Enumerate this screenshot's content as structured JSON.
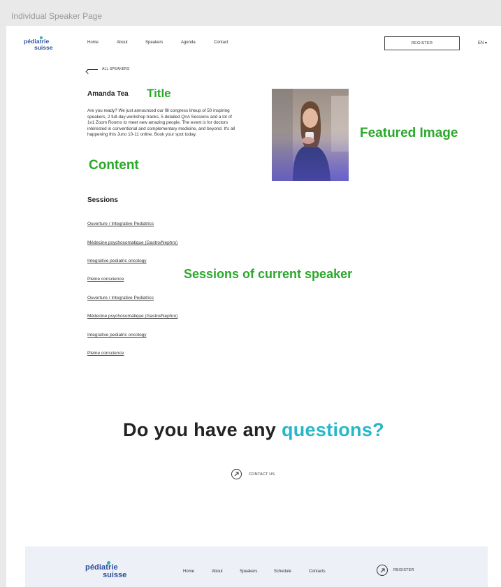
{
  "frame": {
    "label": "Individual Speaker Page"
  },
  "header": {
    "logo": {
      "line1": "pédiatrie",
      "line2": "suisse"
    },
    "nav": [
      "Home",
      "About",
      "Speakers",
      "Agenda",
      "Contact"
    ],
    "register_label": "REGISTER",
    "language": "EN ▾"
  },
  "back_link": {
    "label": "ALL SPEAKERS"
  },
  "speaker": {
    "name": "Amanda Tea",
    "bio": "Are you ready? We just announced our fill congress lineup of 50 inspiring speakers, 2 full-day workshop tracks, 5 detailed QnA Sessions and a lot of 1v1 Zoom Rooms to meet new amazing people. The event is for doctors interested in conventional and complementary medicine, and beyond. It's all happening this Juno 10-11 online. Book your spot today."
  },
  "annotations": {
    "title": "Title",
    "content": "Content",
    "featured_image": "Featured Image",
    "sessions": "Sessions of current speaker"
  },
  "sessions": {
    "heading": "Sessions",
    "items": [
      "Ouverture / Integrative Pediatrics",
      "Médecine psychosomatique (Gastro/Nephro)",
      "Integrative pediatric oncology",
      "Pleine conscience",
      "Ouverture / Integrative Pediatrics",
      "Médecine psychosomatique (Gastro/Nephro)",
      "Integrative pediatric oncology",
      "Pleine conscience"
    ]
  },
  "cta": {
    "prefix": "Do you have any",
    "accent": "questions?"
  },
  "contact": {
    "label": "CONTACT US"
  },
  "footer": {
    "logo": {
      "line1": "pédiatrie",
      "line2": "suisse"
    },
    "nav": [
      "Home",
      "About",
      "Speakers",
      "Schedule",
      "Contacts"
    ],
    "register_label": "REGISTER"
  },
  "colors": {
    "brand_blue": "#2b4f9e",
    "accent_teal": "#26b8c8",
    "annotation_green": "#2aa82a",
    "footer_bg": "#edf0f6"
  }
}
